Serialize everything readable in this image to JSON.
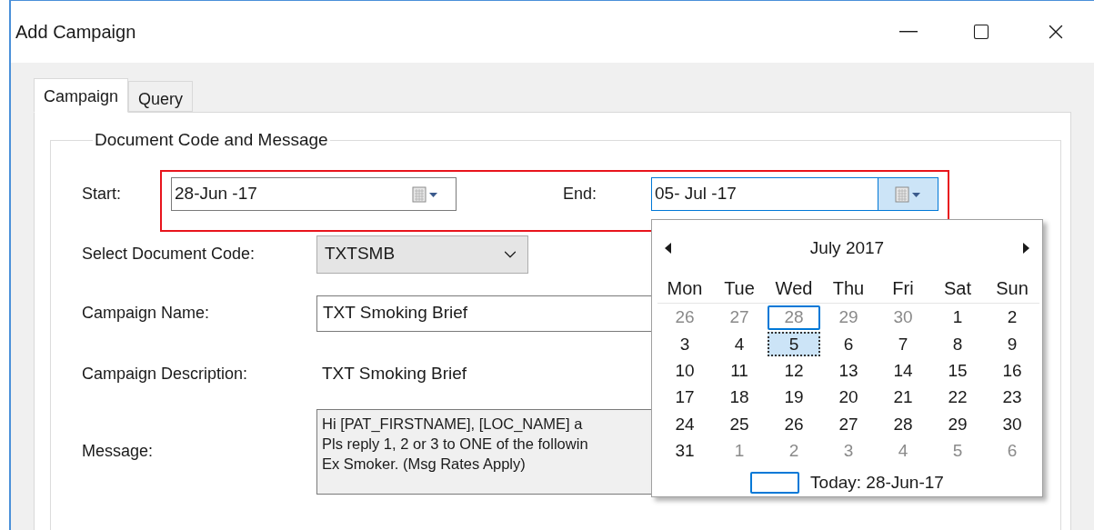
{
  "window": {
    "title": "Add Campaign"
  },
  "tabs": [
    {
      "label": "Campaign",
      "selected": true
    },
    {
      "label": "Query",
      "selected": false
    }
  ],
  "group": {
    "title": "Document Code and Message"
  },
  "start": {
    "label": "Start:",
    "value": "28-Jun -17",
    "focused": false
  },
  "end": {
    "label": "End:",
    "value": "05- Jul -17",
    "focused": true
  },
  "document_code": {
    "label": "Select Document Code:",
    "value": "TXTSMB"
  },
  "campaign_name": {
    "label": "Campaign Name:",
    "value": "TXT Smoking Brief"
  },
  "campaign_description": {
    "label": "Campaign Description:",
    "value": "TXT Smoking Brief"
  },
  "message": {
    "label": "Message:",
    "text": "Hi [PAT_FIRSTNAME], [LOC_NAME] a\nPls reply 1, 2 or 3 to ONE of the followin\nEx Smoker. (Msg Rates Apply)"
  },
  "calendar": {
    "title": "July 2017",
    "weekdays": [
      "Mon",
      "Tue",
      "Wed",
      "Thu",
      "Fri",
      "Sat",
      "Sun"
    ],
    "days": [
      {
        "text": "26",
        "other_month": true,
        "selected": false,
        "today": false
      },
      {
        "text": "27",
        "other_month": true,
        "selected": false,
        "today": false
      },
      {
        "text": "28",
        "other_month": true,
        "selected": false,
        "today": true
      },
      {
        "text": "29",
        "other_month": true,
        "selected": false,
        "today": false
      },
      {
        "text": "30",
        "other_month": true,
        "selected": false,
        "today": false
      },
      {
        "text": "1",
        "other_month": false,
        "selected": false,
        "today": false
      },
      {
        "text": "2",
        "other_month": false,
        "selected": false,
        "today": false
      },
      {
        "text": "3",
        "other_month": false,
        "selected": false,
        "today": false
      },
      {
        "text": "4",
        "other_month": false,
        "selected": false,
        "today": false
      },
      {
        "text": "5",
        "other_month": false,
        "selected": true,
        "today": false
      },
      {
        "text": "6",
        "other_month": false,
        "selected": false,
        "today": false
      },
      {
        "text": "7",
        "other_month": false,
        "selected": false,
        "today": false
      },
      {
        "text": "8",
        "other_month": false,
        "selected": false,
        "today": false
      },
      {
        "text": "9",
        "other_month": false,
        "selected": false,
        "today": false
      },
      {
        "text": "10",
        "other_month": false,
        "selected": false,
        "today": false
      },
      {
        "text": "11",
        "other_month": false,
        "selected": false,
        "today": false
      },
      {
        "text": "12",
        "other_month": false,
        "selected": false,
        "today": false
      },
      {
        "text": "13",
        "other_month": false,
        "selected": false,
        "today": false
      },
      {
        "text": "14",
        "other_month": false,
        "selected": false,
        "today": false
      },
      {
        "text": "15",
        "other_month": false,
        "selected": false,
        "today": false
      },
      {
        "text": "16",
        "other_month": false,
        "selected": false,
        "today": false
      },
      {
        "text": "17",
        "other_month": false,
        "selected": false,
        "today": false
      },
      {
        "text": "18",
        "other_month": false,
        "selected": false,
        "today": false
      },
      {
        "text": "19",
        "other_month": false,
        "selected": false,
        "today": false
      },
      {
        "text": "20",
        "other_month": false,
        "selected": false,
        "today": false
      },
      {
        "text": "21",
        "other_month": false,
        "selected": false,
        "today": false
      },
      {
        "text": "22",
        "other_month": false,
        "selected": false,
        "today": false
      },
      {
        "text": "23",
        "other_month": false,
        "selected": false,
        "today": false
      },
      {
        "text": "24",
        "other_month": false,
        "selected": false,
        "today": false
      },
      {
        "text": "25",
        "other_month": false,
        "selected": false,
        "today": false
      },
      {
        "text": "26",
        "other_month": false,
        "selected": false,
        "today": false
      },
      {
        "text": "27",
        "other_month": false,
        "selected": false,
        "today": false
      },
      {
        "text": "28",
        "other_month": false,
        "selected": false,
        "today": false
      },
      {
        "text": "29",
        "other_month": false,
        "selected": false,
        "today": false
      },
      {
        "text": "30",
        "other_month": false,
        "selected": false,
        "today": false
      },
      {
        "text": "31",
        "other_month": false,
        "selected": false,
        "today": false
      },
      {
        "text": "1",
        "other_month": true,
        "selected": false,
        "today": false
      },
      {
        "text": "2",
        "other_month": true,
        "selected": false,
        "today": false
      },
      {
        "text": "3",
        "other_month": true,
        "selected": false,
        "today": false
      },
      {
        "text": "4",
        "other_month": true,
        "selected": false,
        "today": false
      },
      {
        "text": "5",
        "other_month": true,
        "selected": false,
        "today": false
      },
      {
        "text": "6",
        "other_month": true,
        "selected": false,
        "today": false
      }
    ],
    "today_label": "Today: 28-Jun-17"
  }
}
